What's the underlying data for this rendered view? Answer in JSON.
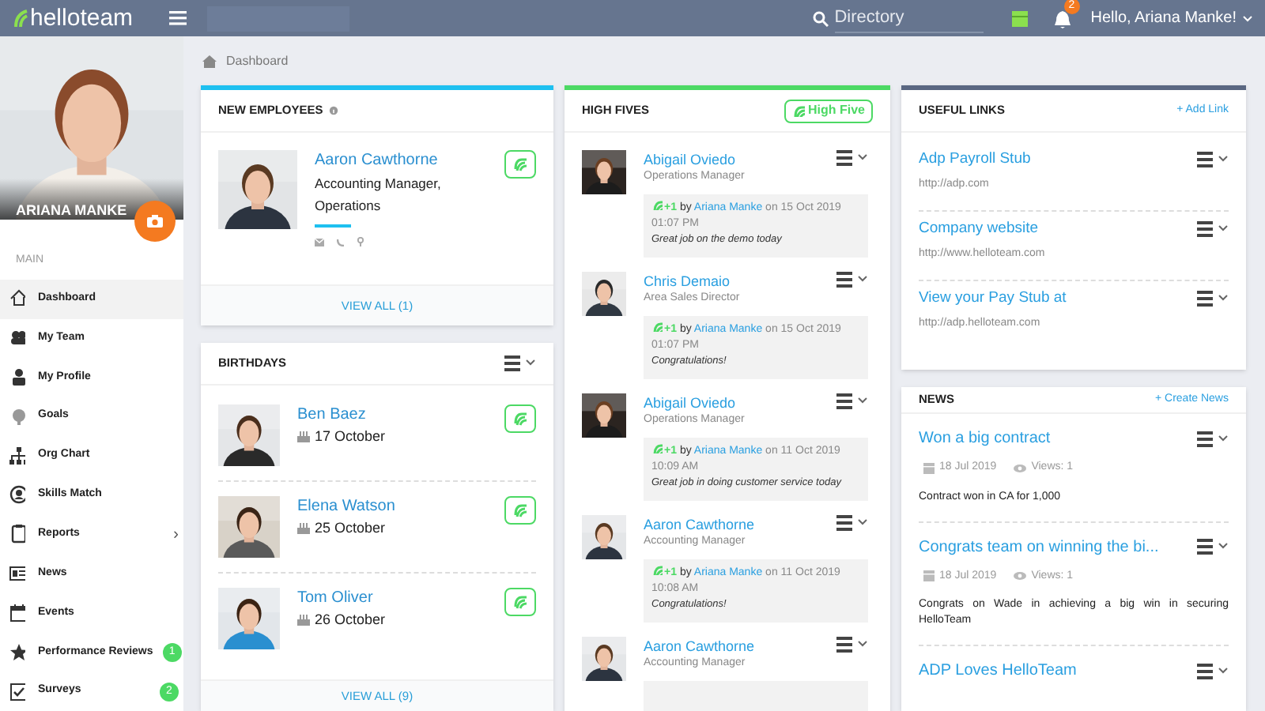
{
  "topbar": {
    "logo": "helloteam",
    "search_placeholder": "Directory",
    "notification_count": "2",
    "user": "Hello, Ariana Manke!"
  },
  "profile": {
    "name": "ARIANA MANKE"
  },
  "sidebar": {
    "section": "MAIN",
    "items": [
      {
        "label": "Dashboard",
        "selected": true
      },
      {
        "label": "My Team",
        "selected": false
      },
      {
        "label": "My Profile",
        "selected": false
      },
      {
        "label": "Goals",
        "selected": false
      },
      {
        "label": "Org Chart",
        "selected": false
      },
      {
        "label": "Skills Match",
        "selected": false
      },
      {
        "label": "Reports",
        "selected": false,
        "chevron": "›"
      },
      {
        "label": "News",
        "selected": false
      },
      {
        "label": "Events",
        "selected": false
      },
      {
        "label": "Performance Reviews",
        "selected": false,
        "badge": "1"
      },
      {
        "label": "Surveys",
        "selected": false,
        "badge": "2"
      }
    ]
  },
  "breadcrumb": "Dashboard",
  "new_employees": {
    "title": "NEW EMPLOYEES",
    "employee": {
      "name": "Aaron Cawthorne",
      "role": "Accounting Manager, Operations"
    },
    "view_all": "VIEW ALL (1)"
  },
  "birthdays": {
    "title": "BIRTHDAYS",
    "people": [
      {
        "name": "Ben Baez",
        "date": "17 October"
      },
      {
        "name": "Elena Watson",
        "date": "25 October"
      },
      {
        "name": "Tom Oliver",
        "date": "26 October"
      }
    ],
    "view_all": "VIEW ALL (9)"
  },
  "high_fives": {
    "title": "HIGH FIVES",
    "button": "High Five",
    "items": [
      {
        "name": "Abigail Oviedo",
        "role": "Operations Manager",
        "plus": "+1",
        "by": "by",
        "giver": "Ariana Manke",
        "when": "on 15 Oct 2019 01:07 PM",
        "message": "Great job on the demo today"
      },
      {
        "name": "Chris Demaio",
        "role": "Area Sales Director",
        "plus": "+1",
        "by": "by",
        "giver": "Ariana Manke",
        "when": "on 15 Oct 2019 01:07 PM",
        "message": "Congratulations!"
      },
      {
        "name": "Abigail Oviedo",
        "role": "Operations Manager",
        "plus": "+1",
        "by": "by",
        "giver": "Ariana Manke",
        "when": "on 11 Oct 2019 10:09 AM",
        "message": "Great job in doing customer service today"
      },
      {
        "name": "Aaron Cawthorne",
        "role": "Accounting Manager",
        "plus": "+1",
        "by": "by",
        "giver": "Ariana Manke",
        "when": "on 11 Oct 2019 10:08 AM",
        "message": "Congratulations!"
      },
      {
        "name": "Aaron Cawthorne",
        "role": "Accounting Manager"
      }
    ]
  },
  "useful_links": {
    "title": "USEFUL LINKS",
    "action": "+ Add Link",
    "links": [
      {
        "title": "Adp Payroll Stub",
        "url": "http://adp.com"
      },
      {
        "title": "Company website",
        "url": "http://www.helloteam.com"
      },
      {
        "title": "View your Pay Stub at",
        "url": "http://adp.helloteam.com"
      }
    ]
  },
  "news": {
    "title": "NEWS",
    "action": "+ Create News",
    "items": [
      {
        "title": "Won a big contract",
        "date": "18 Jul 2019",
        "views": "Views: 1",
        "body": "Contract won in CA for 1,000"
      },
      {
        "title": "Congrats team on winning the bi...",
        "date": "18 Jul 2019",
        "views": "Views: 1",
        "body": "Congrats on Wade in achieving a big win in securing HelloTeam"
      },
      {
        "title": "ADP Loves HelloTeam"
      }
    ]
  }
}
